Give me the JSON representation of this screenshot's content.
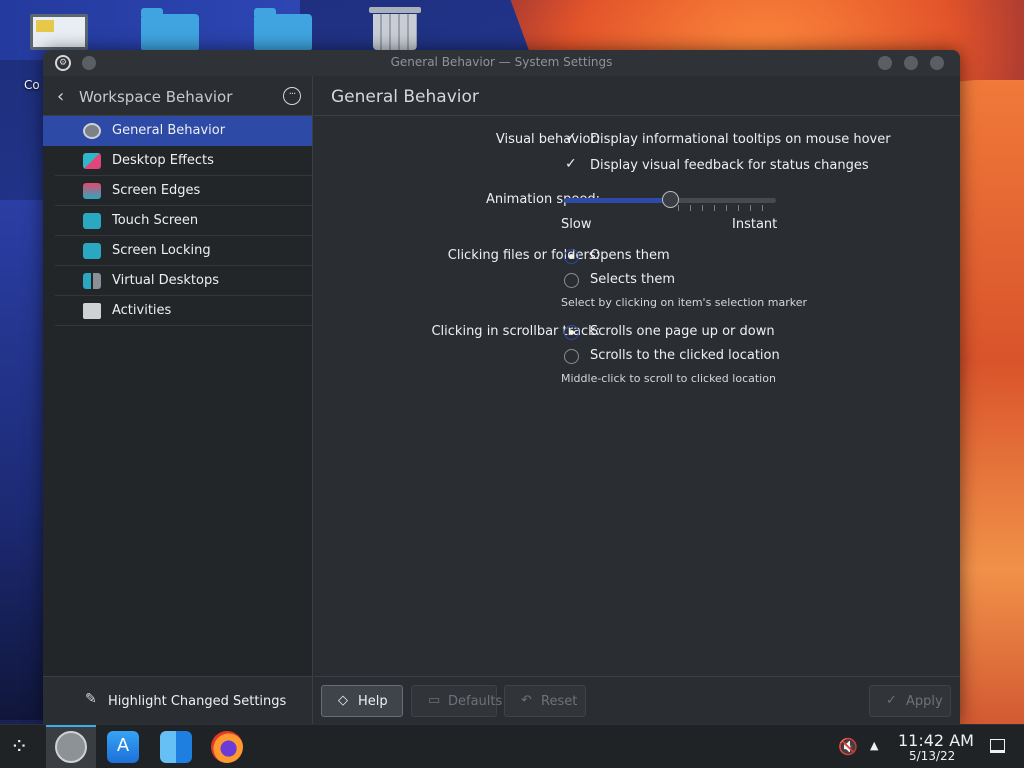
{
  "desktop": {
    "icon_label": "Co"
  },
  "window": {
    "title": "General Behavior — System Settings"
  },
  "sidebar": {
    "title": "Workspace Behavior",
    "items": [
      {
        "label": "General Behavior",
        "icon": "general-behavior-icon",
        "active": true
      },
      {
        "label": "Desktop Effects",
        "icon": "desktop-effects-icon"
      },
      {
        "label": "Screen Edges",
        "icon": "screen-edges-icon"
      },
      {
        "label": "Touch Screen",
        "icon": "touch-screen-icon"
      },
      {
        "label": "Screen Locking",
        "icon": "screen-locking-icon"
      },
      {
        "label": "Virtual Desktops",
        "icon": "virtual-desktops-icon"
      },
      {
        "label": "Activities",
        "icon": "activities-icon"
      }
    ],
    "footer_label": "Highlight Changed Settings"
  },
  "main": {
    "title": "General Behavior",
    "visual_behavior": {
      "label": "Visual behavior:",
      "tooltips": {
        "label": "Display informational tooltips on mouse hover",
        "checked": true
      },
      "feedback": {
        "label": "Display visual feedback for status changes",
        "checked": true
      }
    },
    "animation_speed": {
      "label": "Animation speed:",
      "min_label": "Slow",
      "max_label": "Instant",
      "value_fraction": 0.5
    },
    "clicking_files": {
      "label": "Clicking files or folders:",
      "options": [
        {
          "label": "Opens them",
          "selected": true
        },
        {
          "label": "Selects them",
          "selected": false
        }
      ],
      "hint": "Select by clicking on item's selection marker"
    },
    "clicking_scrollbar": {
      "label": "Clicking in scrollbar track:",
      "options": [
        {
          "label": "Scrolls one page up or down",
          "selected": true
        },
        {
          "label": "Scrolls to the clicked location",
          "selected": false
        }
      ],
      "hint": "Middle-click to scroll to clicked location"
    }
  },
  "buttons": {
    "help": "Help",
    "defaults": "Defaults",
    "reset": "Reset",
    "apply": "Apply"
  },
  "taskbar": {
    "time": "11:42 AM",
    "date": "5/13/22"
  },
  "colors": {
    "accent": "#2c4aa6",
    "window_bg": "#2a2e32",
    "sidebar_bg": "#232629"
  }
}
